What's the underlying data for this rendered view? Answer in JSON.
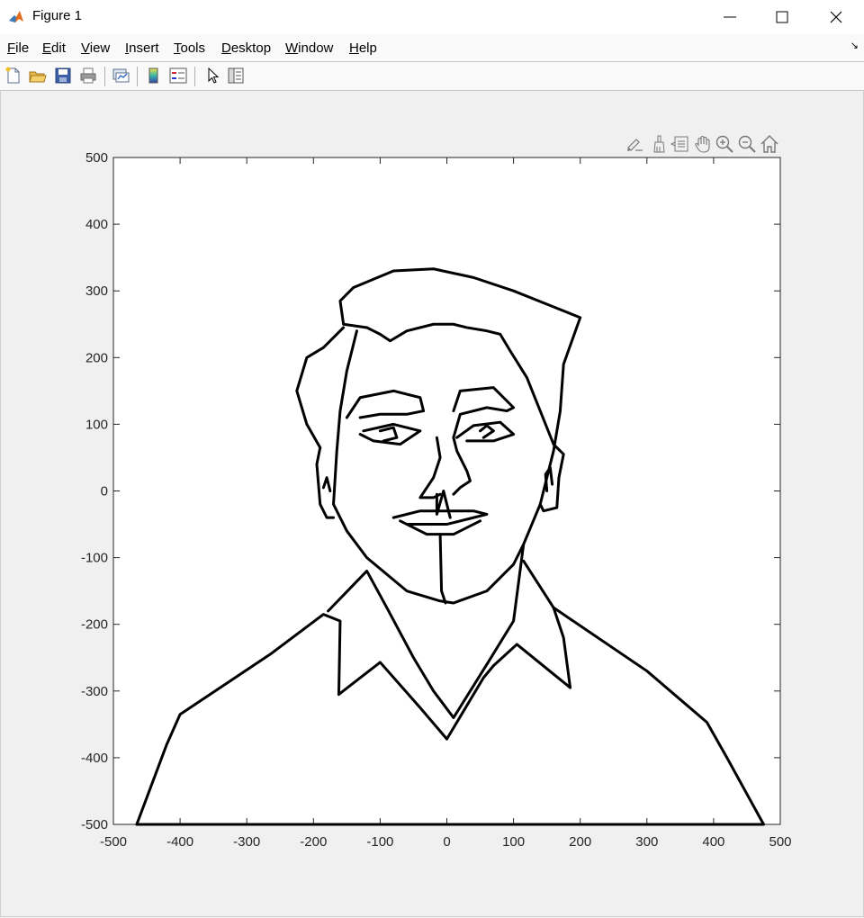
{
  "window": {
    "title": "Figure 1",
    "app_icon": "matlab-logo-icon",
    "controls": [
      "minimize-icon",
      "maximize-icon",
      "close-icon"
    ]
  },
  "menu": {
    "items": [
      {
        "label": "File",
        "mnemonic": "F",
        "rest": "ile"
      },
      {
        "label": "Edit",
        "mnemonic": "E",
        "rest": "dit"
      },
      {
        "label": "View",
        "mnemonic": "V",
        "rest": "iew"
      },
      {
        "label": "Insert",
        "mnemonic": "I",
        "rest": "nsert"
      },
      {
        "label": "Tools",
        "mnemonic": "T",
        "rest": "ools"
      },
      {
        "label": "Desktop",
        "mnemonic": "D",
        "rest": "esktop"
      },
      {
        "label": "Window",
        "mnemonic": "W",
        "rest": "indow"
      },
      {
        "label": "Help",
        "mnemonic": "H",
        "rest": "elp"
      }
    ]
  },
  "toolbar": {
    "buttons": [
      "new-figure-icon",
      "open-file-icon",
      "save-icon",
      "print-icon",
      "link-plot-icon",
      "insert-colorbar-icon",
      "insert-legend-icon",
      "edit-plot-arrow-icon",
      "property-inspector-icon"
    ]
  },
  "axes_toolbar": {
    "buttons": [
      "brush-edit-icon",
      "data-brush-icon",
      "data-tips-icon",
      "pan-hand-icon",
      "zoom-in-icon",
      "zoom-out-icon",
      "restore-view-home-icon"
    ]
  },
  "chart_data": {
    "type": "line",
    "title": "",
    "xlabel": "",
    "ylabel": "",
    "xlim": [
      -500,
      500
    ],
    "ylim": [
      -500,
      500
    ],
    "xticks": [
      -500,
      -400,
      -300,
      -200,
      -100,
      0,
      100,
      200,
      300,
      400,
      500
    ],
    "yticks": [
      -500,
      -400,
      -300,
      -200,
      -100,
      0,
      100,
      200,
      300,
      400,
      500
    ],
    "xtick_labels": [
      "-500",
      "-400",
      "-300",
      "-200",
      "-100",
      "0",
      "100",
      "200",
      "300",
      "400",
      "500"
    ],
    "ytick_labels": [
      "-500",
      "-400",
      "-300",
      "-200",
      "-100",
      "0",
      "100",
      "200",
      "300",
      "400",
      "500"
    ],
    "grid": false,
    "line_color": "#000000",
    "series": [
      {
        "points": [
          [
            -465,
            -500
          ],
          [
            -420,
            -380
          ],
          [
            -400,
            -335
          ],
          [
            -265,
            -245
          ],
          [
            -185,
            -185
          ],
          [
            -160,
            -195
          ],
          [
            -162,
            -305
          ]
        ]
      },
      {
        "points": [
          [
            -162,
            -305
          ],
          [
            -100,
            -257
          ],
          [
            -40,
            -325
          ],
          [
            0,
            -372
          ],
          [
            55,
            -280
          ],
          [
            70,
            -262
          ],
          [
            105,
            -230
          ],
          [
            185,
            -295
          ],
          [
            175,
            -220
          ],
          [
            160,
            -175
          ],
          [
            115,
            -105
          ]
        ]
      },
      {
        "points": [
          [
            160,
            -175
          ],
          [
            300,
            -270
          ],
          [
            390,
            -347
          ],
          [
            420,
            -400
          ],
          [
            475,
            -500
          ],
          [
            -465,
            -500
          ]
        ]
      },
      {
        "points": [
          [
            -178,
            -180
          ],
          [
            -120,
            -120
          ],
          [
            -90,
            -175
          ],
          [
            -50,
            -250
          ],
          [
            -20,
            -300
          ],
          [
            10,
            -340
          ],
          [
            60,
            -260
          ],
          [
            100,
            -195
          ],
          [
            115,
            -80
          ],
          [
            140,
            -20
          ],
          [
            160,
            60
          ],
          [
            170,
            120
          ],
          [
            175,
            190
          ],
          [
            200,
            260
          ],
          [
            150,
            280
          ],
          [
            100,
            300
          ],
          [
            40,
            320
          ],
          [
            -20,
            333
          ],
          [
            -80,
            330
          ],
          [
            -140,
            305
          ],
          [
            -160,
            285
          ],
          [
            -155,
            250
          ],
          [
            -120,
            245
          ]
        ]
      },
      {
        "points": [
          [
            -155,
            245
          ],
          [
            -185,
            215
          ],
          [
            -210,
            200
          ],
          [
            -225,
            150
          ],
          [
            -210,
            100
          ],
          [
            -190,
            65
          ]
        ]
      },
      {
        "points": [
          [
            -120,
            245
          ],
          [
            -100,
            235
          ],
          [
            -85,
            225
          ],
          [
            -60,
            240
          ],
          [
            -20,
            250
          ],
          [
            10,
            250
          ],
          [
            30,
            245
          ],
          [
            60,
            240
          ],
          [
            80,
            235
          ],
          [
            95,
            210
          ],
          [
            120,
            170
          ],
          [
            140,
            120
          ],
          [
            160,
            70
          ]
        ]
      },
      {
        "points": [
          [
            -135,
            240
          ],
          [
            -150,
            180
          ],
          [
            -160,
            120
          ],
          [
            -165,
            60
          ],
          [
            -170,
            -20
          ],
          [
            -160,
            -40
          ],
          [
            -150,
            -60
          ],
          [
            -120,
            -100
          ],
          [
            -60,
            -150
          ],
          [
            -10,
            -165
          ],
          [
            10,
            -168
          ],
          [
            60,
            -150
          ],
          [
            100,
            -110
          ],
          [
            115,
            -80
          ]
        ]
      },
      {
        "points": [
          [
            -190,
            65
          ],
          [
            -195,
            40
          ],
          [
            -190,
            -20
          ],
          [
            -180,
            -40
          ],
          [
            -170,
            -40
          ]
        ]
      },
      {
        "points": [
          [
            160,
            70
          ],
          [
            175,
            55
          ],
          [
            168,
            20
          ],
          [
            165,
            -25
          ],
          [
            145,
            -30
          ],
          [
            140,
            -20
          ]
        ]
      },
      {
        "points": [
          [
            -185,
            5
          ],
          [
            -180,
            20
          ],
          [
            -175,
            0
          ]
        ]
      },
      {
        "points": [
          [
            150,
            0
          ],
          [
            148,
            25
          ],
          [
            155,
            35
          ],
          [
            158,
            10
          ]
        ]
      },
      {
        "points": [
          [
            -150,
            110
          ],
          [
            -130,
            140
          ],
          [
            -80,
            150
          ],
          [
            -40,
            140
          ],
          [
            -35,
            120
          ],
          [
            -60,
            115
          ],
          [
            -100,
            115
          ],
          [
            -130,
            110
          ]
        ]
      },
      {
        "points": [
          [
            -125,
            90
          ],
          [
            -80,
            100
          ],
          [
            -40,
            90
          ],
          [
            -70,
            70
          ],
          [
            -110,
            75
          ],
          [
            -130,
            85
          ]
        ]
      },
      {
        "points": [
          [
            -100,
            90
          ],
          [
            -80,
            95
          ],
          [
            -75,
            80
          ],
          [
            -95,
            75
          ]
        ]
      },
      {
        "points": [
          [
            -15,
            80
          ],
          [
            -10,
            50
          ],
          [
            -20,
            20
          ],
          [
            -40,
            -10
          ],
          [
            -20,
            -10
          ],
          [
            -10,
            -5
          ]
        ]
      },
      {
        "points": [
          [
            10,
            120
          ],
          [
            20,
            150
          ],
          [
            70,
            155
          ],
          [
            100,
            125
          ],
          [
            90,
            120
          ],
          [
            60,
            125
          ],
          [
            20,
            115
          ],
          [
            10,
            80
          ]
        ]
      },
      {
        "points": [
          [
            15,
            80
          ],
          [
            40,
            98
          ],
          [
            80,
            103
          ],
          [
            100,
            85
          ],
          [
            70,
            75
          ],
          [
            30,
            75
          ]
        ]
      },
      {
        "points": [
          [
            50,
            90
          ],
          [
            60,
            98
          ],
          [
            70,
            90
          ],
          [
            55,
            80
          ]
        ]
      },
      {
        "points": [
          [
            10,
            80
          ],
          [
            15,
            60
          ],
          [
            30,
            30
          ],
          [
            35,
            15
          ],
          [
            20,
            5
          ],
          [
            10,
            -5
          ]
        ]
      },
      {
        "points": [
          [
            -15,
            -5
          ],
          [
            -15,
            -35
          ],
          [
            -5,
            0
          ],
          [
            5,
            -40
          ]
        ]
      },
      {
        "points": [
          [
            -80,
            -40
          ],
          [
            -40,
            -30
          ],
          [
            0,
            -30
          ],
          [
            40,
            -30
          ],
          [
            60,
            -35
          ],
          [
            40,
            -40
          ],
          [
            0,
            -50
          ],
          [
            -40,
            -50
          ],
          [
            -60,
            -50
          ]
        ]
      },
      {
        "points": [
          [
            -70,
            -45
          ],
          [
            -30,
            -65
          ],
          [
            10,
            -65
          ],
          [
            50,
            -45
          ]
        ]
      },
      {
        "points": [
          [
            -10,
            -65
          ],
          [
            -8,
            -150
          ],
          [
            -2,
            -168
          ]
        ]
      }
    ]
  }
}
